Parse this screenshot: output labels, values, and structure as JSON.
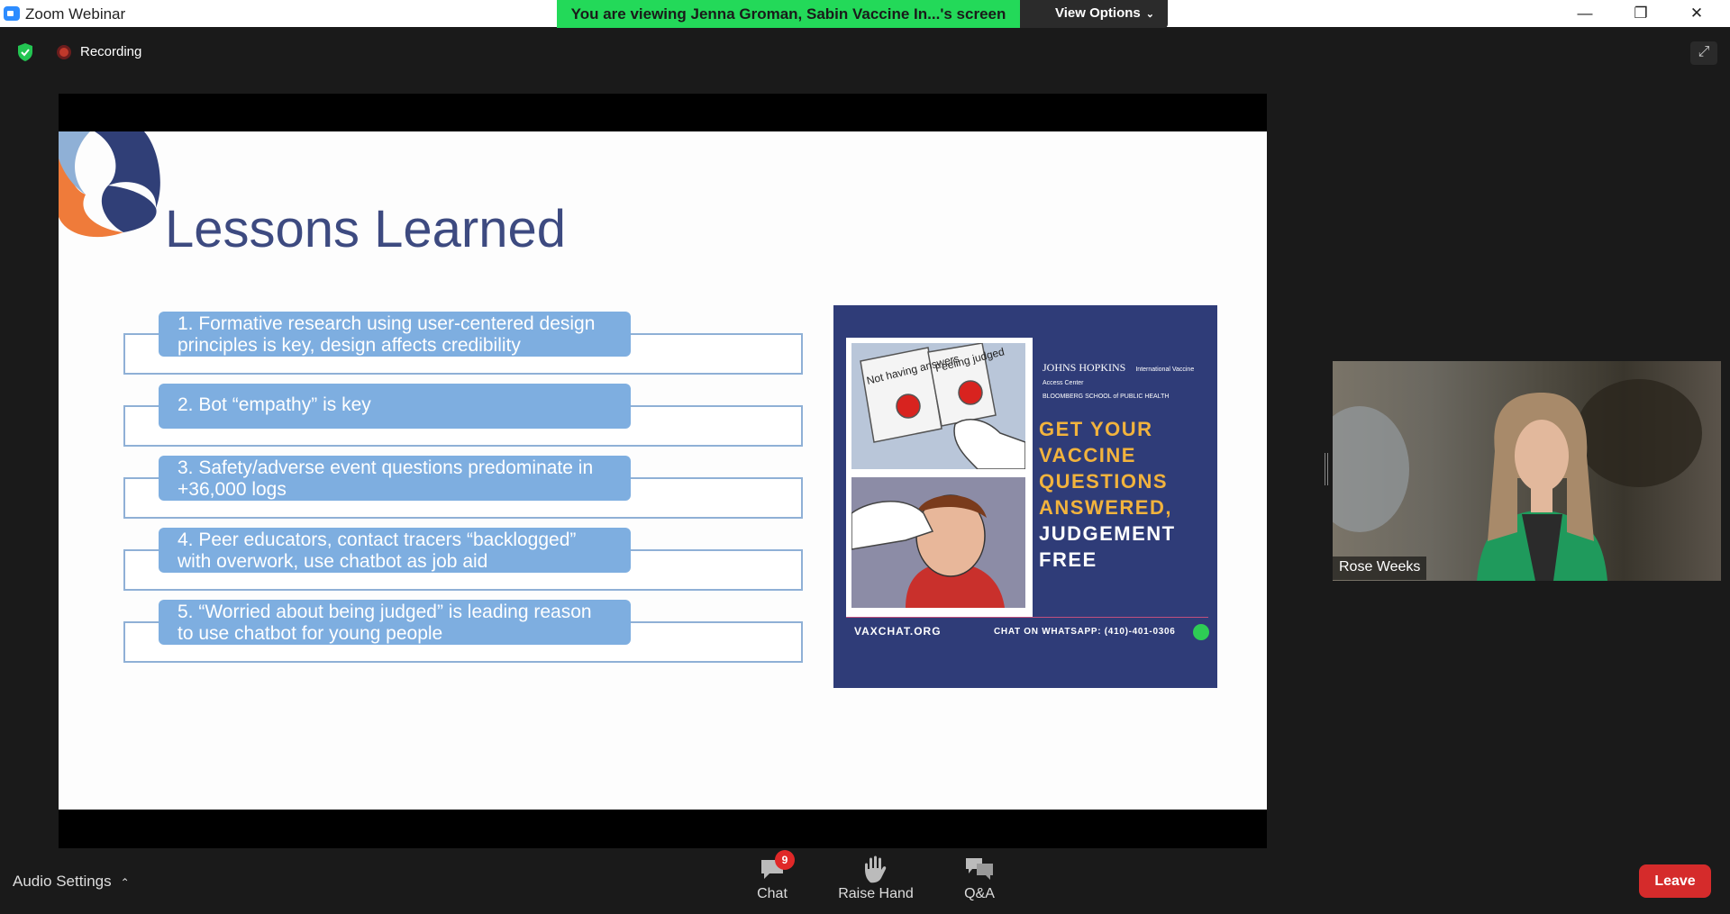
{
  "window": {
    "title": "Zoom Webinar",
    "minimize": "—",
    "restore": "❐",
    "close": "✕"
  },
  "banner": {
    "viewing": "You are viewing Jenna Groman, Sabin Vaccine In...'s screen",
    "view_options": "View Options"
  },
  "recording": {
    "label": "Recording"
  },
  "slide": {
    "title": "Lessons Learned",
    "lessons": [
      "1. Formative research using user-centered design principles is key, design affects credibility",
      "2. Bot “empathy” is key",
      "3. Safety/adverse event questions predominate in +36,000 logs",
      "4. Peer educators, contact tracers “backlogged” with overwork, use chatbot as job aid",
      "5. “Worried about being judged” is leading reason to use chatbot for young people"
    ],
    "poster": {
      "meme_button_1": "Not having answers",
      "meme_button_2": "Feeling judged",
      "org_name": "JOHNS HOPKINS",
      "org_sub": "BLOOMBERG SCHOOL of PUBLIC HEALTH",
      "org_center": "International Vaccine Access Center",
      "cta_gold": "GET YOUR VACCINE QUESTIONS ANSWERED,",
      "cta_white": "JUDGEMENT FREE",
      "url": "VAXCHAT.ORG",
      "chat": "CHAT ON WHATSAPP: (410)-401-0306"
    }
  },
  "participant": {
    "name": "Rose Weeks"
  },
  "toolbar": {
    "audio_settings": "Audio Settings",
    "chat_label": "Chat",
    "chat_badge": "9",
    "raise_hand_label": "Raise Hand",
    "qa_label": "Q&A",
    "leave_label": "Leave"
  },
  "colors": {
    "banner_green": "#23d959",
    "slide_title": "#3d4a80",
    "lesson_pill": "#7eaee0",
    "poster_bg": "#2f3c78",
    "poster_gold": "#f2b33d",
    "leave_red": "#d52b2b",
    "badge_red": "#e02828"
  }
}
